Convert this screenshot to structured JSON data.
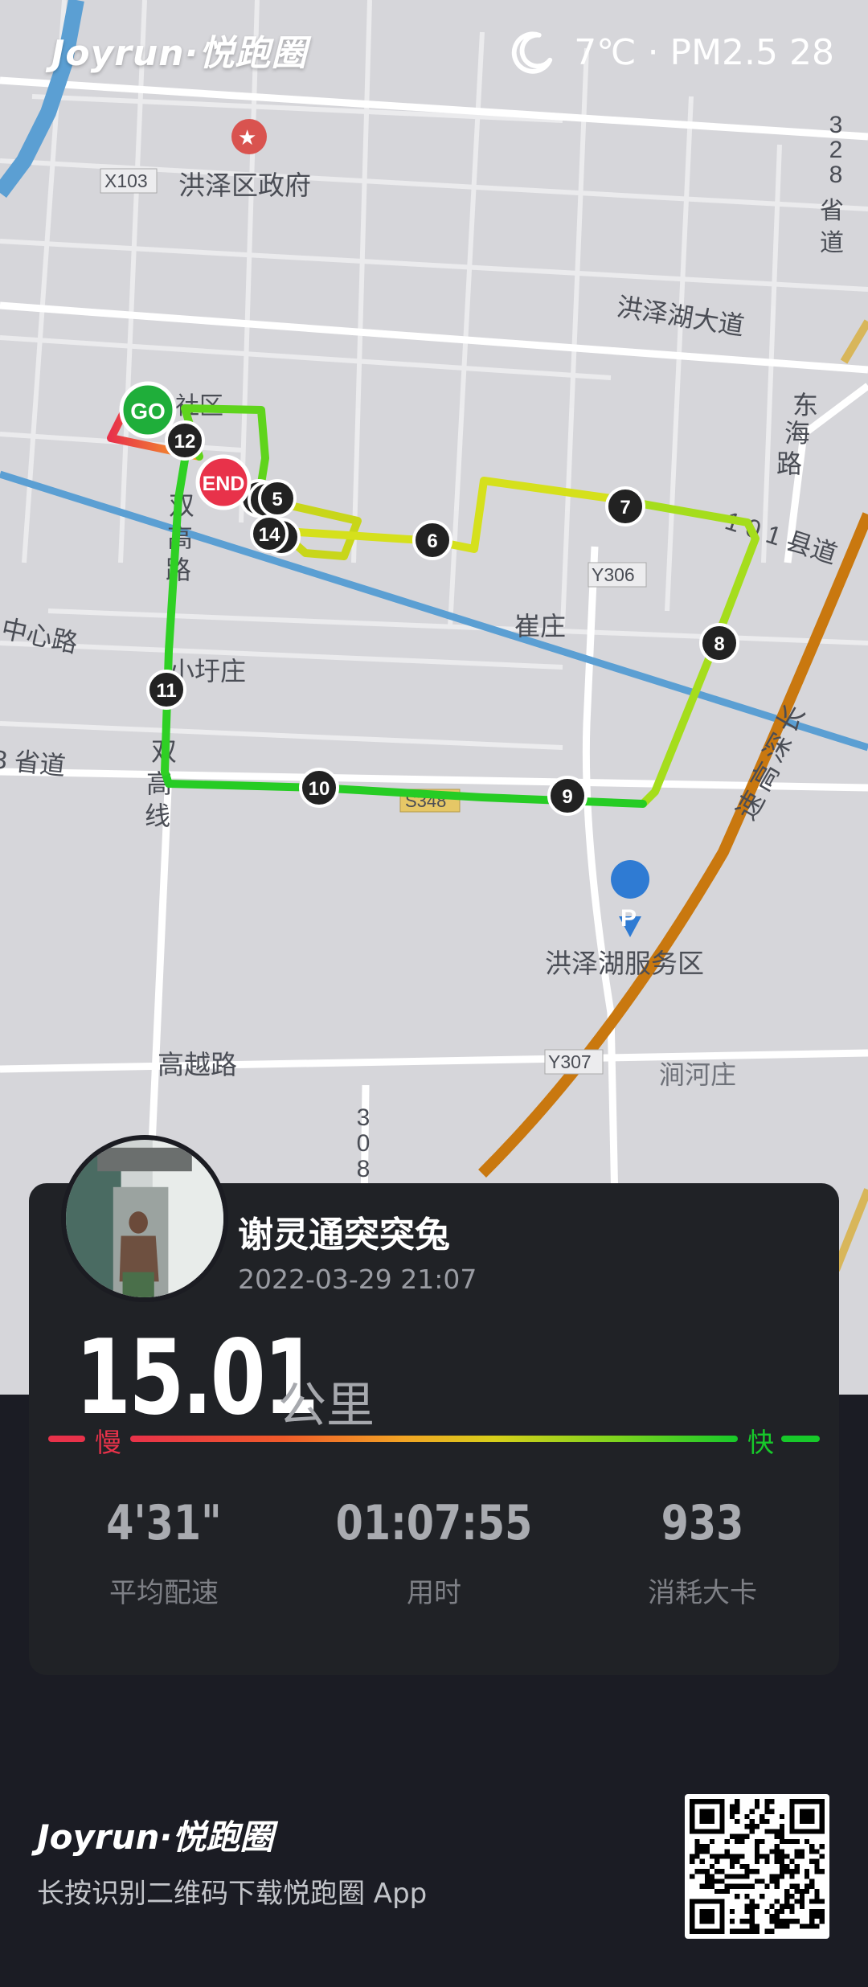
{
  "header": {
    "brand": "Joyrun·悦跑圈",
    "weather_icon": "moon-icon",
    "weather_text": "7℃ · PM2.5 28"
  },
  "map": {
    "labels": {
      "x103": "X103",
      "government": "洪泽区政府",
      "road_328_1": "3",
      "road_328_2": "2",
      "road_328_3": "8",
      "road_328_4": "省",
      "road_328_5": "道",
      "hongze_avenue": "洪泽湖大道",
      "donghai_1": "东",
      "donghai_2": "海",
      "donghai_3": "路",
      "county_101": "1 0 1 县道",
      "shequ": "社区",
      "shuanggao_1": "双",
      "shuanggao_2": "高",
      "shuanggao_3": "路",
      "y306": "Y306",
      "cuizhuang": "崔庄",
      "center_road": "中心路",
      "xiaoyuzhuang": "小圩庄",
      "provincial_road": "3 省道",
      "shuanggao_line_1": "双",
      "shuanggao_line_2": "高",
      "shuanggao_line_3": "线",
      "s348": "S348",
      "changshen_1": "长",
      "changshen_2": "深",
      "changshen_3": "高",
      "changshen_4": "速",
      "service_area": "洪泽湖服务区",
      "gaoyue_road": "高越路",
      "y307": "Y307",
      "jianhezhuang": "涧河庄",
      "road_308_1": "3",
      "road_308_2": "0",
      "road_308_3": "8"
    },
    "start_marker": "GO",
    "end_marker": "END",
    "km_markers": [
      "5",
      "6",
      "7",
      "8",
      "9",
      "10",
      "11",
      "12",
      "14"
    ]
  },
  "card": {
    "username": "谢灵通突突兔",
    "datetime": "2022-03-29 21:07",
    "distance": "15.01",
    "distance_unit": "公里",
    "legend_slow": "慢",
    "legend_fast": "快",
    "stats": [
      {
        "value": "4'31\"",
        "label": "平均配速"
      },
      {
        "value": "01:07:55",
        "label": "用时"
      },
      {
        "value": "933",
        "label": "消耗大卡"
      }
    ]
  },
  "footer": {
    "brand": "Joyrun·悦跑圈",
    "text": "长按识别二维码下载悦跑圈 App",
    "qr_icon": "qr-code-icon"
  },
  "colors": {
    "map_bg": "#d4d4d8",
    "route_fast": "#17c92a",
    "route_mid": "#d7cf1a",
    "route_slow": "#e8324a",
    "card_bg": "#202226",
    "page_bg": "#1b1c24"
  }
}
